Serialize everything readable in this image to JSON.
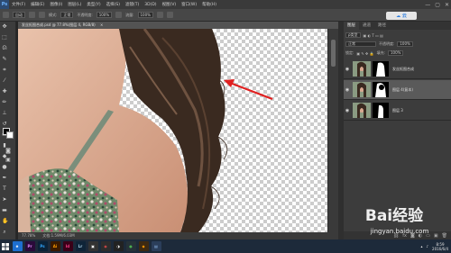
{
  "app": {
    "logo": "Ps",
    "menu": [
      "文件(F)",
      "编辑(E)",
      "图像(I)",
      "图层(L)",
      "类型(Y)",
      "选择(S)",
      "滤镜(T)",
      "3D(D)",
      "视图(V)",
      "窗口(W)",
      "帮助(H)"
    ],
    "window_controls": [
      "—",
      "▢",
      "✕"
    ]
  },
  "options": {
    "preset": "自动",
    "mode": "正常",
    "opacity_label": "不透明度:",
    "opacity": "100%",
    "flow_label": "流量:",
    "flow": "100%",
    "cloud_label": "云"
  },
  "document": {
    "tab_title": "发丝抠图合成.psd @ 77.8%(图层 4, RGB/8)",
    "zoom": "77.78%",
    "doc_size": "文档:1.59M/6.03M"
  },
  "panel": {
    "tabs": [
      "图层",
      "通道",
      "路径"
    ],
    "kind_label": "ρ类型",
    "blend_mode": "正常",
    "opacity_label": "不透明度:",
    "opacity": "100%",
    "lock_label": "锁定:",
    "fill_label": "填充:",
    "fill": "100%",
    "layers": [
      {
        "name": "发丝抠图合成",
        "selected": false
      },
      {
        "name": "图层 4(复本)",
        "selected": true
      },
      {
        "name": "图层 3",
        "selected": false
      }
    ]
  },
  "taskbar": {
    "apps": [
      {
        "label": "e",
        "color": "#1e6fd0",
        "text": "#ffffff"
      },
      {
        "label": "Pr",
        "color": "#2a0a3a",
        "text": "#e08cff"
      },
      {
        "label": "Ps",
        "color": "#0b2238",
        "text": "#31a8ff"
      },
      {
        "label": "Ai",
        "color": "#3a1a00",
        "text": "#ff9a00"
      },
      {
        "label": "Id",
        "color": "#3a0018",
        "text": "#ff3d8b"
      },
      {
        "label": "Lr",
        "color": "#0f2438",
        "text": "#add5ec"
      },
      {
        "label": "▣",
        "color": "#333333",
        "text": "#ffffff"
      },
      {
        "label": "◉",
        "color": "#2d2d2d",
        "text": "#e34b4b"
      },
      {
        "label": "◑",
        "color": "#222222",
        "text": "#ffffff"
      },
      {
        "label": "●",
        "color": "#263238",
        "text": "#4caf50"
      },
      {
        "label": "◆",
        "color": "#3d2a12",
        "text": "#ff9800"
      },
      {
        "label": "▤",
        "color": "#2b3e5a",
        "text": "#9ec9ff"
      }
    ],
    "time": "8:59",
    "date": "2016/6/4"
  },
  "watermark": {
    "text": "Bai经验",
    "url": "jingyan.baidu.com"
  },
  "colors": {
    "arrow": "#e02020",
    "selection": "#5a5a5a"
  }
}
